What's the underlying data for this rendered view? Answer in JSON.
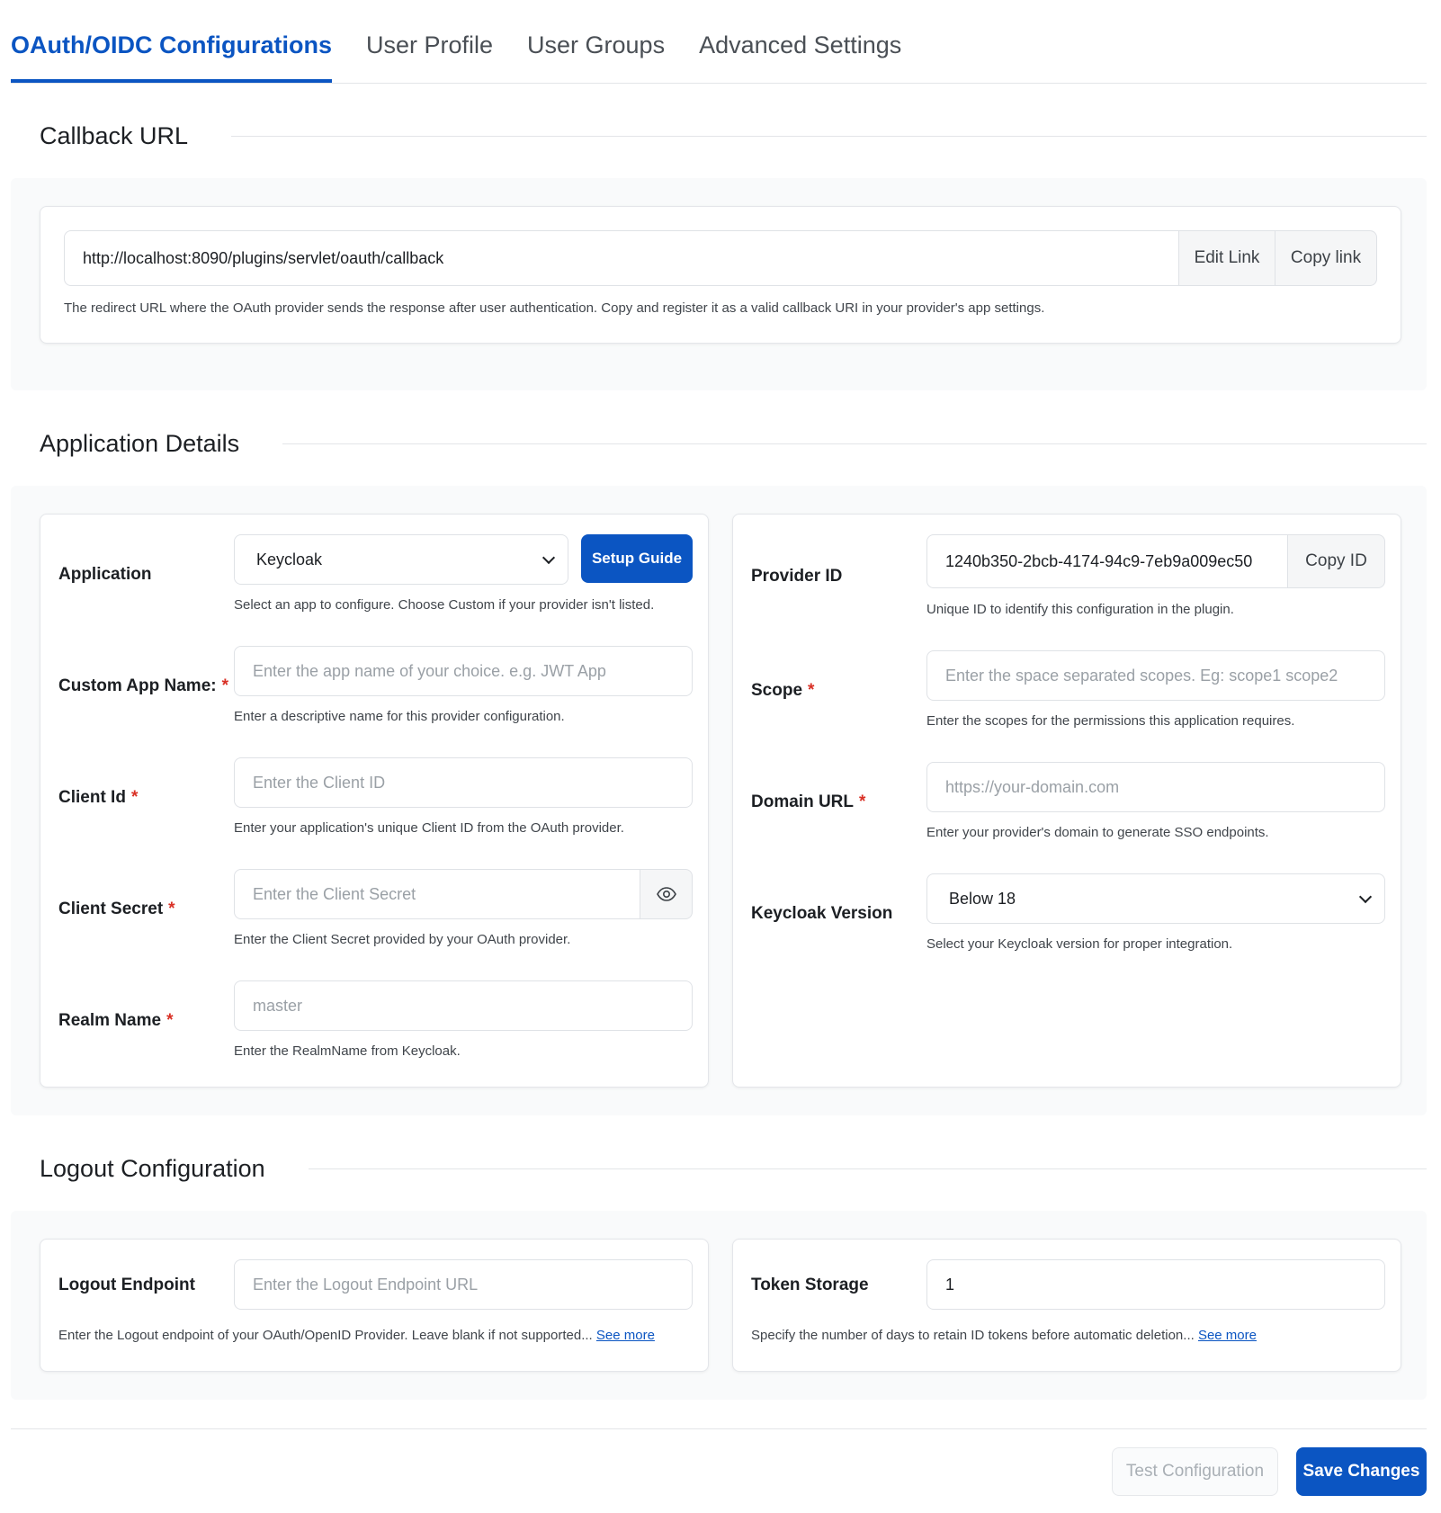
{
  "tabs": [
    {
      "label": "OAuth/OIDC Configurations",
      "active": true
    },
    {
      "label": "User Profile",
      "active": false
    },
    {
      "label": "User Groups",
      "active": false
    },
    {
      "label": "Advanced Settings",
      "active": false
    }
  ],
  "callback": {
    "heading": "Callback URL",
    "url": "http://localhost:8090/plugins/servlet/oauth/callback",
    "edit_label": "Edit Link",
    "copy_label": "Copy link",
    "help": "The redirect URL where the OAuth provider sends the response after user authentication. Copy and register it as a valid callback URI in your provider's app settings."
  },
  "app_details": {
    "heading": "Application Details",
    "application": {
      "label": "Application",
      "value": "Keycloak",
      "setup_guide": "Setup Guide",
      "help": "Select an app to configure. Choose Custom if your provider isn't listed."
    },
    "custom_app_name": {
      "label": "Custom App Name:",
      "placeholder": "Enter the app name of your choice. e.g. JWT App",
      "help": "Enter a descriptive name for this provider configuration."
    },
    "client_id": {
      "label": "Client Id",
      "placeholder": "Enter the Client ID",
      "help": "Enter your application's unique Client ID from the OAuth provider."
    },
    "client_secret": {
      "label": "Client Secret",
      "placeholder": "Enter the Client Secret",
      "help": "Enter the Client Secret provided by your OAuth provider.",
      "icon": "eye-icon"
    },
    "realm_name": {
      "label": "Realm Name",
      "placeholder": "master",
      "help": "Enter the RealmName from Keycloak."
    },
    "provider_id": {
      "label": "Provider ID",
      "value": "1240b350-2bcb-4174-94c9-7eb9a009ec50",
      "copy_label": "Copy ID",
      "help": "Unique ID to identify this configuration in the plugin."
    },
    "scope": {
      "label": "Scope",
      "placeholder": "Enter the space separated scopes. Eg: scope1 scope2",
      "help": "Enter the scopes for the permissions this application requires."
    },
    "domain_url": {
      "label": "Domain URL",
      "placeholder": "https://your-domain.com",
      "help": "Enter your provider's domain to generate SSO endpoints."
    },
    "keycloak_version": {
      "label": "Keycloak Version",
      "value": "Below 18",
      "help": "Select your Keycloak version for proper integration."
    }
  },
  "logout": {
    "heading": "Logout Configuration",
    "endpoint": {
      "label": "Logout Endpoint",
      "placeholder": "Enter the Logout Endpoint URL",
      "help": "Enter the Logout endpoint of your OAuth/OpenID Provider. Leave blank if not supported...",
      "see_more": "See more"
    },
    "token_storage": {
      "label": "Token Storage",
      "value": "1",
      "help": "Specify the number of days to retain ID tokens before automatic deletion...",
      "see_more": "See more"
    }
  },
  "footer": {
    "test_label": "Test Configuration",
    "save_label": "Save Changes"
  },
  "required_mark": "*",
  "colors": {
    "accent": "#0b55c2",
    "required": "#d93025"
  }
}
